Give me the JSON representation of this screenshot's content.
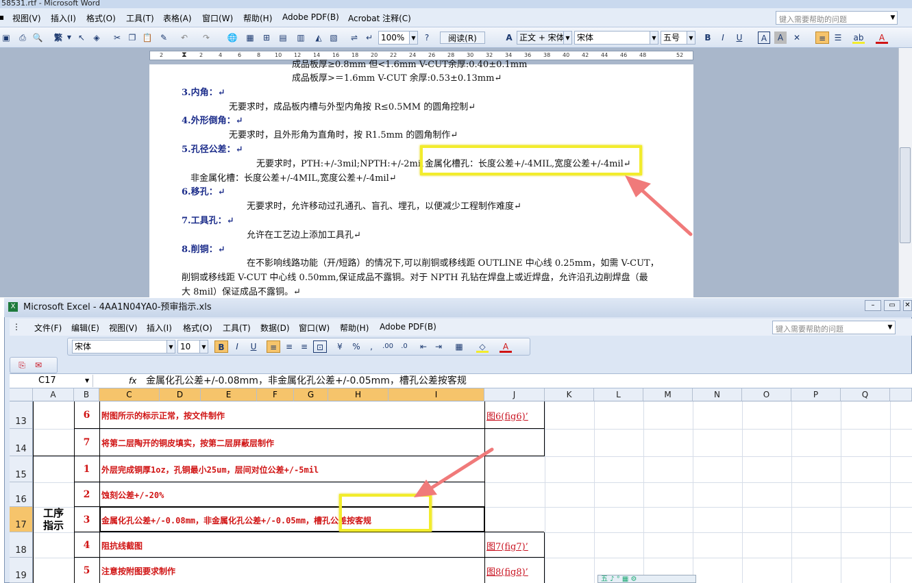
{
  "word": {
    "title": "58531.rtf - Microsoft Word",
    "menu": [
      "视图(V)",
      "插入(I)",
      "格式(O)",
      "工具(T)",
      "表格(A)",
      "窗口(W)",
      "帮助(H)",
      "Adobe PDF(B)",
      "Acrobat 注释(C)"
    ],
    "help_placeholder": "键入需要帮助的问题",
    "toolbar": {
      "trad": "繁",
      "zoom": "100%",
      "read": "阅读(R)",
      "style": "正文 + 宋体",
      "font": "宋体",
      "size": "五号"
    },
    "ruler": [
      "2",
      "2",
      "4",
      "6",
      "8",
      "10",
      "12",
      "14",
      "16",
      "18",
      "20",
      "22",
      "24",
      "26",
      "28",
      "30",
      "32",
      "34",
      "36",
      "38",
      "40",
      "42",
      "44",
      "46",
      "48",
      "52"
    ],
    "lines": [
      "成品板厚≥0.8mm 但<1.6mm  V-CUT余厚:0.40±0.1mm",
      "成品板厚>＝1.6mm         V-CUT 余厚:0.53±0.13mm↵",
      "3.内角：↵",
      "无要求时，成品板内槽与外型内角按 R≤0.5MM 的圆角控制↵",
      "4.外形倒角：↵",
      "无要求时，且外形角为直角时，按 R1.5mm 的圆角制作↵",
      "5.孔径公差：↵",
      "无要求时，PTH:+/-3mil;NPTH:+/-2mil",
      "金属化槽孔：长度公差+/-4MIL,宽度公差+/-4mil↵",
      "非金属化槽：长度公差+/-4MIL,宽度公差+/-4mil↵",
      "6.移孔：↵",
      "无要求时，允许移动过孔通孔、盲孔、埋孔，以便减少工程制作难度↵",
      "7.工具孔：↵",
      "允许在工艺边上添加工具孔↵",
      "8.削铜：↵",
      "在不影响线路功能（开/短路）的情况下,可以削铜或移线距 OUTLINE 中心线 0.25mm，如需 V-CUT，",
      "削铜或移线距 V-CUT 中心线 0.50mm,保证成品不露铜。对于 NPTH 孔钻在焊盘上或近焊盘，允许沿孔边削焊盘（最",
      "大 8mil）保证成品不露铜。↵"
    ]
  },
  "excel": {
    "title": "Microsoft Excel - 4AA1N04YA0-预审指示.xls",
    "menu": [
      "文件(F)",
      "编辑(E)",
      "视图(V)",
      "插入(I)",
      "格式(O)",
      "工具(T)",
      "数据(D)",
      "窗口(W)",
      "帮助(H)",
      "Adobe PDF(B)"
    ],
    "help_placeholder": "键入需要帮助的问题",
    "font": "宋体",
    "size": "10",
    "name_box": "C17",
    "fx": "fx",
    "formula": "金属化孔公差+/-0.08mm，非金属化孔公差+/-0.05mm，槽孔公差按客规",
    "columns": [
      "A",
      "B",
      "C",
      "D",
      "E",
      "F",
      "G",
      "H",
      "I",
      "J",
      "K",
      "L",
      "M",
      "N",
      "O",
      "P",
      "Q"
    ],
    "section_label": "工序\n指示",
    "rows": [
      {
        "row": "13",
        "num": "6",
        "text": "附图所示的标示正常，按文件制作",
        "link": "图6(fig6)’"
      },
      {
        "row": "14",
        "num": "7",
        "text": "将第二层陶开的铜皮填实，按第二层屏蔽层制作",
        "link": ""
      },
      {
        "row": "15",
        "num": "1",
        "text": "外层完成铜厚1oz，孔铜最小25um，层间对位公差+/-5mil",
        "link": ""
      },
      {
        "row": "16",
        "num": "2",
        "text": "蚀刻公差+/-20%",
        "link": ""
      },
      {
        "row": "17",
        "num": "3",
        "text": "金属化孔公差+/-0.08mm，非金属化孔公差+/-0.05mm，槽孔公差按客规",
        "link": ""
      },
      {
        "row": "18",
        "num": "4",
        "text": "阻抗线截图",
        "link": "图7(fig7)’"
      },
      {
        "row": "19",
        "num": "5",
        "text": "注意按附图要求制作",
        "link": "图8(fig8)’"
      }
    ],
    "ime": "五 ♪ ° ▦ ⚙"
  },
  "colors": {
    "highlight": "#f2ec2c",
    "arrow": "#f07a7a",
    "cell_text": "#d01414",
    "heading": "#1b2c8a"
  }
}
